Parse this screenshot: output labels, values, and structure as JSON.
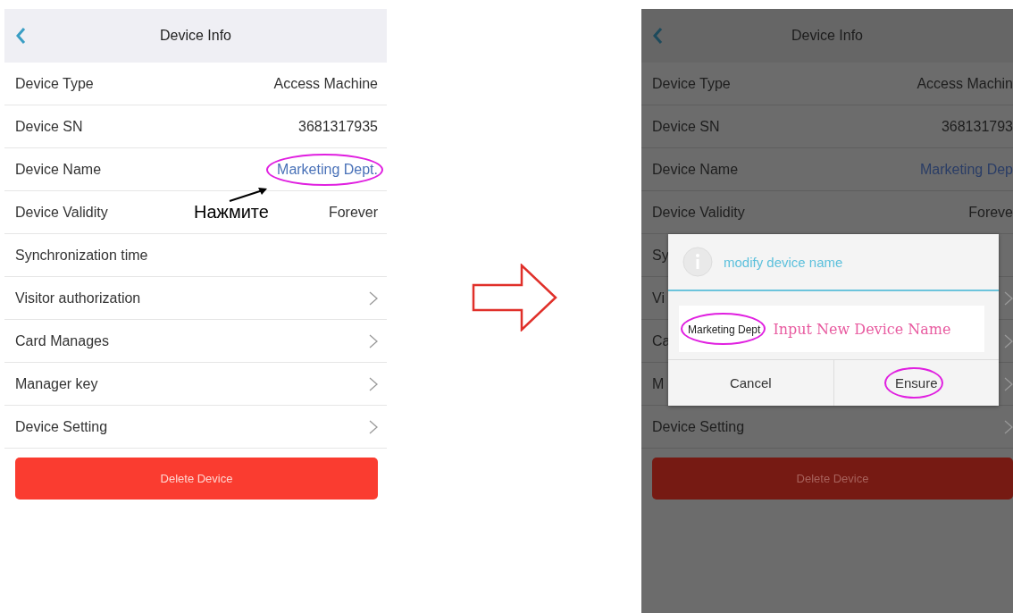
{
  "screens": [
    {
      "kind": "normal",
      "title": "Device Info",
      "hint": "Нажмите",
      "rows": [
        {
          "kind": "value",
          "label": "Device Type",
          "value": "Access Machine",
          "editable": false,
          "highlighted": false
        },
        {
          "kind": "value",
          "label": "Device SN",
          "value": "3681317935",
          "editable": false,
          "highlighted": false
        },
        {
          "kind": "value",
          "label": "Device Name",
          "value": "Marketing Dept.",
          "editable": true,
          "highlighted": true
        },
        {
          "kind": "value",
          "label": "Device Validity",
          "value": "Forever",
          "editable": false,
          "highlighted": false
        },
        {
          "kind": "plain",
          "label": "Synchronization time"
        },
        {
          "kind": "link",
          "label": "Visitor authorization"
        },
        {
          "kind": "link",
          "label": "Card Manages"
        },
        {
          "kind": "link",
          "label": "Manager key"
        },
        {
          "kind": "link",
          "label": "Device Setting"
        }
      ],
      "delete_button": "Delete Device"
    },
    {
      "kind": "dimmed",
      "title": "Device Info",
      "rows": [
        {
          "kind": "value",
          "label": "Device Type",
          "value": "Access Machin",
          "editable": false,
          "highlighted": false
        },
        {
          "kind": "value",
          "label": "Device SN",
          "value": "368131793",
          "editable": false,
          "highlighted": false
        },
        {
          "kind": "value",
          "label": "Device Name",
          "value": "Marketing Dep",
          "editable": true,
          "highlighted": false
        },
        {
          "kind": "value",
          "label": "Device Validity",
          "value": "Foreve",
          "editable": false,
          "highlighted": false
        },
        {
          "kind": "plain",
          "label": "Sy"
        },
        {
          "kind": "link",
          "label": "Vi"
        },
        {
          "kind": "link",
          "label": "Ca"
        },
        {
          "kind": "link",
          "label": "M"
        },
        {
          "kind": "link",
          "label": "Device Setting"
        }
      ],
      "delete_button": "Delete Device",
      "dialog": {
        "title": "modify device name",
        "field_label": "Marketing Dept",
        "field_label_highlighted": true,
        "placeholder": "Input New Device Name",
        "buttons": [
          {
            "label": "Cancel",
            "highlighted": false
          },
          {
            "label": "Ensure",
            "highlighted": true
          }
        ]
      }
    }
  ]
}
